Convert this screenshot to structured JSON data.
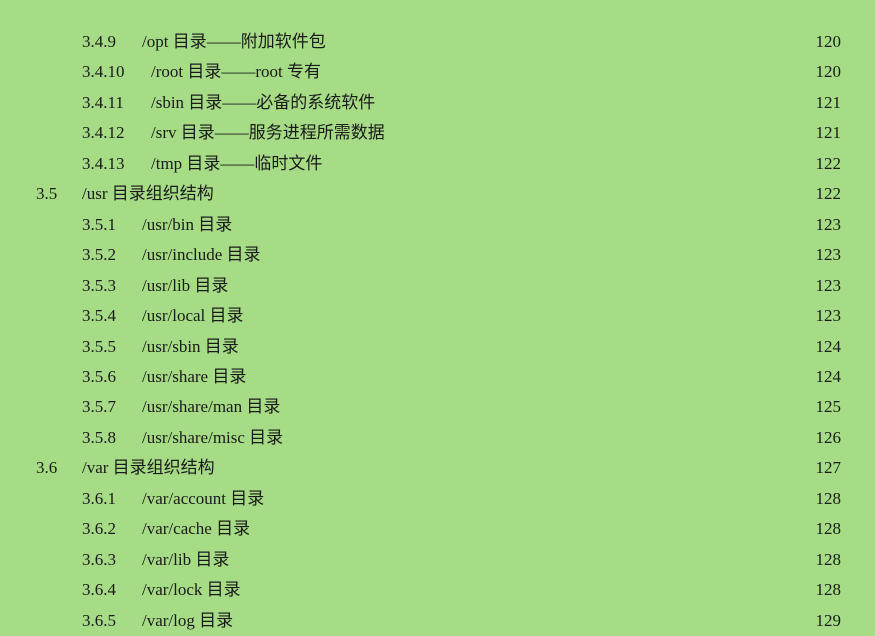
{
  "entries": [
    {
      "num": "3.4.9",
      "title": "/opt 目录——附加软件包",
      "page": "120",
      "level": "sub",
      "wide": false
    },
    {
      "num": "3.4.10",
      "title": "/root 目录——root 专有",
      "page": "120",
      "level": "sub",
      "wide": true
    },
    {
      "num": "3.4.11",
      "title": "/sbin 目录——必备的系统软件",
      "page": "121",
      "level": "sub",
      "wide": true
    },
    {
      "num": "3.4.12",
      "title": "/srv 目录——服务进程所需数据",
      "page": "121",
      "level": "sub",
      "wide": true
    },
    {
      "num": "3.4.13",
      "title": "/tmp 目录——临时文件",
      "page": "122",
      "level": "sub",
      "wide": true
    },
    {
      "num": "3.5",
      "title": "/usr 目录组织结构",
      "page": "122",
      "level": "sec",
      "wide": false
    },
    {
      "num": "3.5.1",
      "title": "/usr/bin 目录",
      "page": "123",
      "level": "sub",
      "wide": false
    },
    {
      "num": "3.5.2",
      "title": "/usr/include 目录",
      "page": "123",
      "level": "sub",
      "wide": false
    },
    {
      "num": "3.5.3",
      "title": "/usr/lib 目录",
      "page": "123",
      "level": "sub",
      "wide": false
    },
    {
      "num": "3.5.4",
      "title": "/usr/local 目录",
      "page": "123",
      "level": "sub",
      "wide": false
    },
    {
      "num": "3.5.5",
      "title": "/usr/sbin 目录",
      "page": "124",
      "level": "sub",
      "wide": false
    },
    {
      "num": "3.5.6",
      "title": "/usr/share 目录",
      "page": "124",
      "level": "sub",
      "wide": false
    },
    {
      "num": "3.5.7",
      "title": "/usr/share/man 目录",
      "page": "125",
      "level": "sub",
      "wide": false
    },
    {
      "num": "3.5.8",
      "title": "/usr/share/misc 目录",
      "page": "126",
      "level": "sub",
      "wide": false
    },
    {
      "num": "3.6",
      "title": "/var 目录组织结构",
      "page": "127",
      "level": "sec",
      "wide": false
    },
    {
      "num": "3.6.1",
      "title": "/var/account 目录",
      "page": "128",
      "level": "sub",
      "wide": false
    },
    {
      "num": "3.6.2",
      "title": "/var/cache 目录",
      "page": "128",
      "level": "sub",
      "wide": false
    },
    {
      "num": "3.6.3",
      "title": "/var/lib 目录",
      "page": "128",
      "level": "sub",
      "wide": false
    },
    {
      "num": "3.6.4",
      "title": "/var/lock 目录",
      "page": "128",
      "level": "sub",
      "wide": false
    },
    {
      "num": "3.6.5",
      "title": "/var/log 目录",
      "page": "129",
      "level": "sub",
      "wide": false
    }
  ]
}
